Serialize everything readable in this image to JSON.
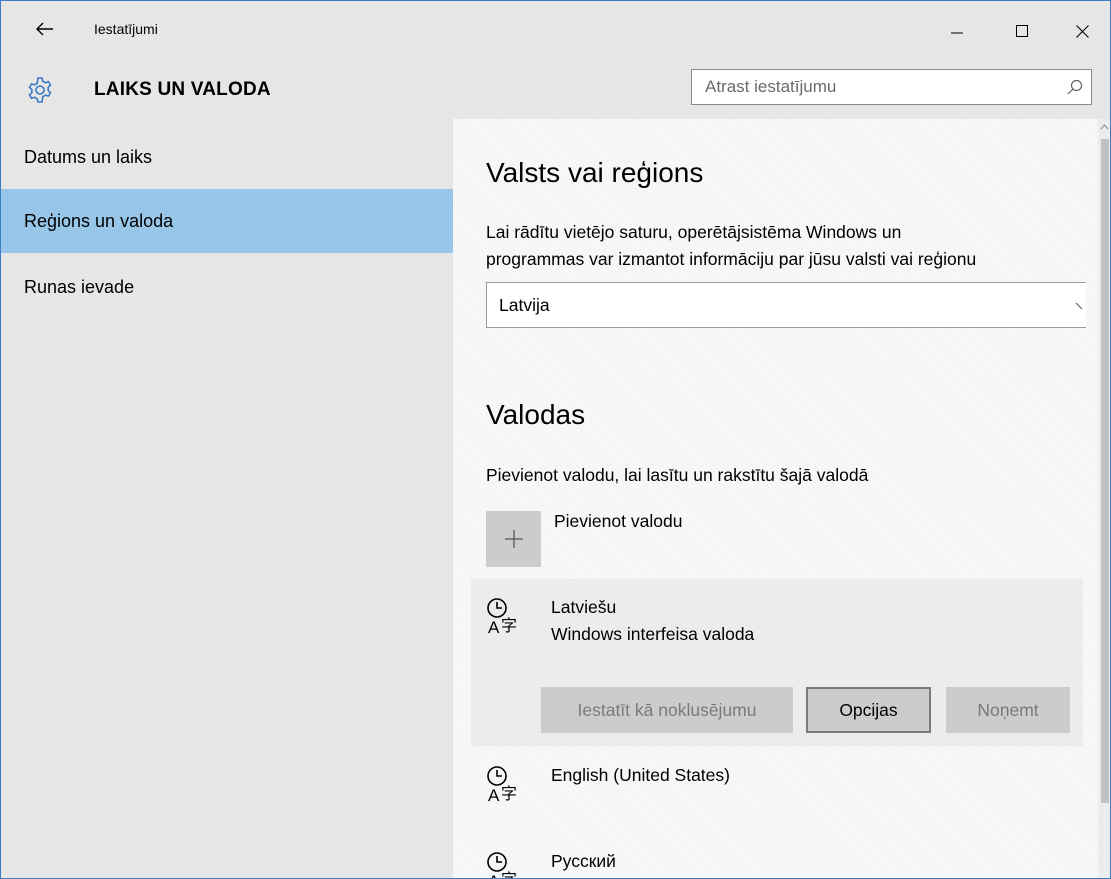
{
  "window": {
    "title": "Iestatījumi"
  },
  "header": {
    "section_title": "LAIKS UN VALODA",
    "search_placeholder": "Atrast iestatījumu"
  },
  "sidebar": {
    "items": [
      {
        "label": "Datums un laiks",
        "active": false
      },
      {
        "label": "Reģions un valoda",
        "active": true
      },
      {
        "label": "Runas ievade",
        "active": false
      }
    ]
  },
  "region": {
    "heading": "Valsts vai reģions",
    "description_line1": "Lai rādītu vietējo saturu, operētājsistēma Windows un",
    "description_line2": "programmas var izmantot informāciju par jūsu valsti vai reģionu",
    "selected": "Latvija"
  },
  "languages": {
    "heading": "Valodas",
    "description": "Pievienot valodu, lai lasītu un rakstītu šajā valodā",
    "add_label": "Pievienot valodu",
    "items": [
      {
        "name": "Latviešu",
        "sub": "Windows interfeisa valoda"
      },
      {
        "name": "English (United States)",
        "sub": ""
      },
      {
        "name": "Русский",
        "sub": ""
      }
    ],
    "buttons": {
      "set_default": "Iestatīt kā noklusējumu",
      "options": "Opcijas",
      "remove": "Noņemt"
    }
  },
  "colors": {
    "accent": "#3a7cc7",
    "sidebar_active": "#97c6e9",
    "chrome_bg": "#e6e6e6"
  }
}
